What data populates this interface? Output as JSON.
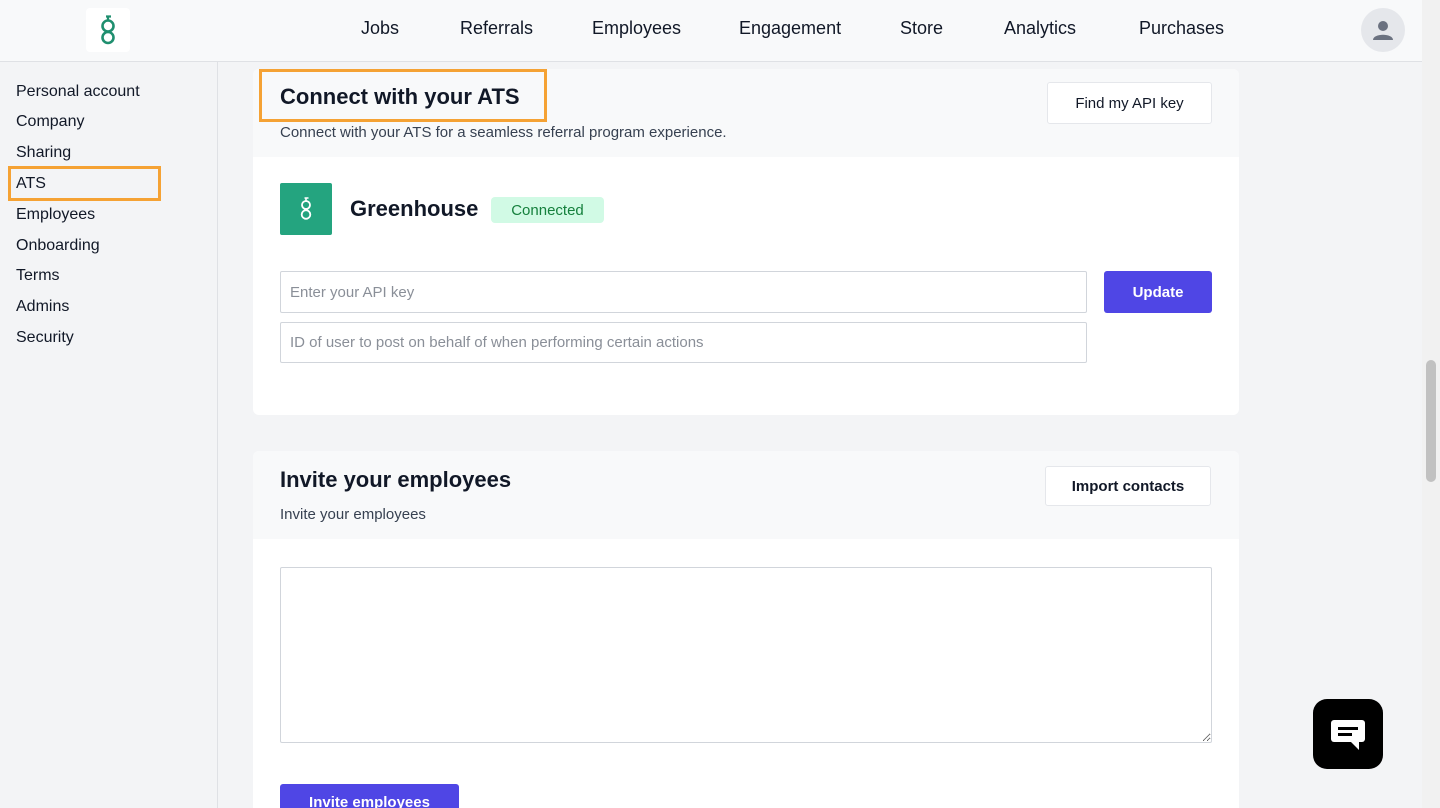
{
  "nav": {
    "links": [
      "Jobs",
      "Referrals",
      "Employees",
      "Engagement",
      "Store",
      "Analytics",
      "Purchases"
    ]
  },
  "sidebar": {
    "items": [
      {
        "label": "Personal account"
      },
      {
        "label": "Company"
      },
      {
        "label": "Sharing"
      },
      {
        "label": "ATS"
      },
      {
        "label": "Employees"
      },
      {
        "label": "Onboarding"
      },
      {
        "label": "Terms"
      },
      {
        "label": "Admins"
      },
      {
        "label": "Security"
      }
    ],
    "selected": "ATS"
  },
  "ats_card": {
    "title": "Connect with your ATS",
    "subtitle": "Connect with your ATS for a seamless referral program experience.",
    "api_key_button": "Find my API key",
    "integration_name": "Greenhouse",
    "status_badge": "Connected",
    "api_key_placeholder": "Enter your API key",
    "user_id_placeholder": "ID of user to post on behalf of when performing certain actions",
    "update_button": "Update"
  },
  "invite_card": {
    "title": "Invite your employees",
    "subtitle": "Invite your employees",
    "import_button": "Import contacts",
    "invite_button": "Invite employees"
  },
  "colors": {
    "primary": "#4f46e5",
    "greenhouse": "#24a47f",
    "highlight": "#f5a234",
    "badge_bg": "#d1fae5",
    "badge_text": "#15803d"
  },
  "icons": {
    "logo": "greenhouse-g-icon",
    "avatar": "user-icon",
    "chat": "chat-icon"
  }
}
